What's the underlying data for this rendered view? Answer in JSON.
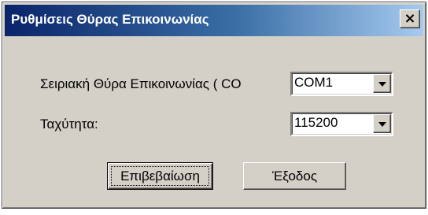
{
  "window": {
    "title": "Ρυθμίσεις Θύρας Επικοινωνίας",
    "close_glyph": "×"
  },
  "form": {
    "port_label": "Σειριακή Θύρα Επικοινωνίας ( CO",
    "port_value": "COM1",
    "speed_label": "Ταχύτητα:",
    "speed_value": "115200"
  },
  "buttons": {
    "confirm_label": "Επιβεβαίωση",
    "exit_label": "Έξοδος"
  },
  "icons": {
    "close": "close-icon",
    "dropdown": "chevron-down-icon"
  },
  "colors": {
    "titlebar_start": "#0a246a",
    "titlebar_end": "#a6caf0",
    "face": "#d4d0c8"
  }
}
